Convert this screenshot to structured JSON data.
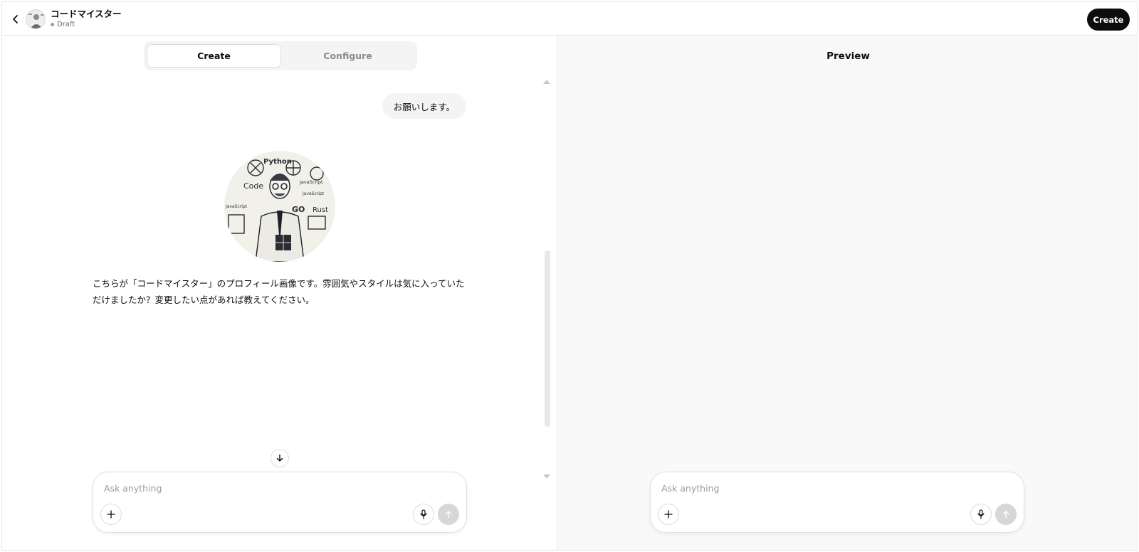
{
  "header": {
    "gpt_name": "コードマイスター",
    "status": "Draft",
    "create_button": "Create"
  },
  "tabs": [
    {
      "label": "Create",
      "active": true
    },
    {
      "label": "Configure",
      "active": false
    }
  ],
  "chat": {
    "user_message": "お願いします。",
    "assistant_message": "こちらが「コードマイスター」のプロフィール画像です。雰囲気やスタイルは気に入っていただけましたか？変更したい点があれば教えてください。",
    "profile_image_labels": [
      "Python",
      "JavaScript",
      "Code",
      "GO",
      "Rust"
    ]
  },
  "composer": {
    "placeholder": "Ask anything"
  },
  "preview": {
    "title": "Preview",
    "composer_placeholder": "Ask anything"
  },
  "icons": {
    "back": "chevron-left-icon",
    "plus": "plus-icon",
    "mic": "microphone-icon",
    "send": "arrow-up-icon",
    "scroll_bottom": "arrow-down-icon"
  },
  "colors": {
    "accent_button": "#0d0d0d",
    "tab_bg": "#f4f4f4",
    "preview_bg": "#f9f9f9",
    "send_disabled": "#d7d7d7"
  }
}
